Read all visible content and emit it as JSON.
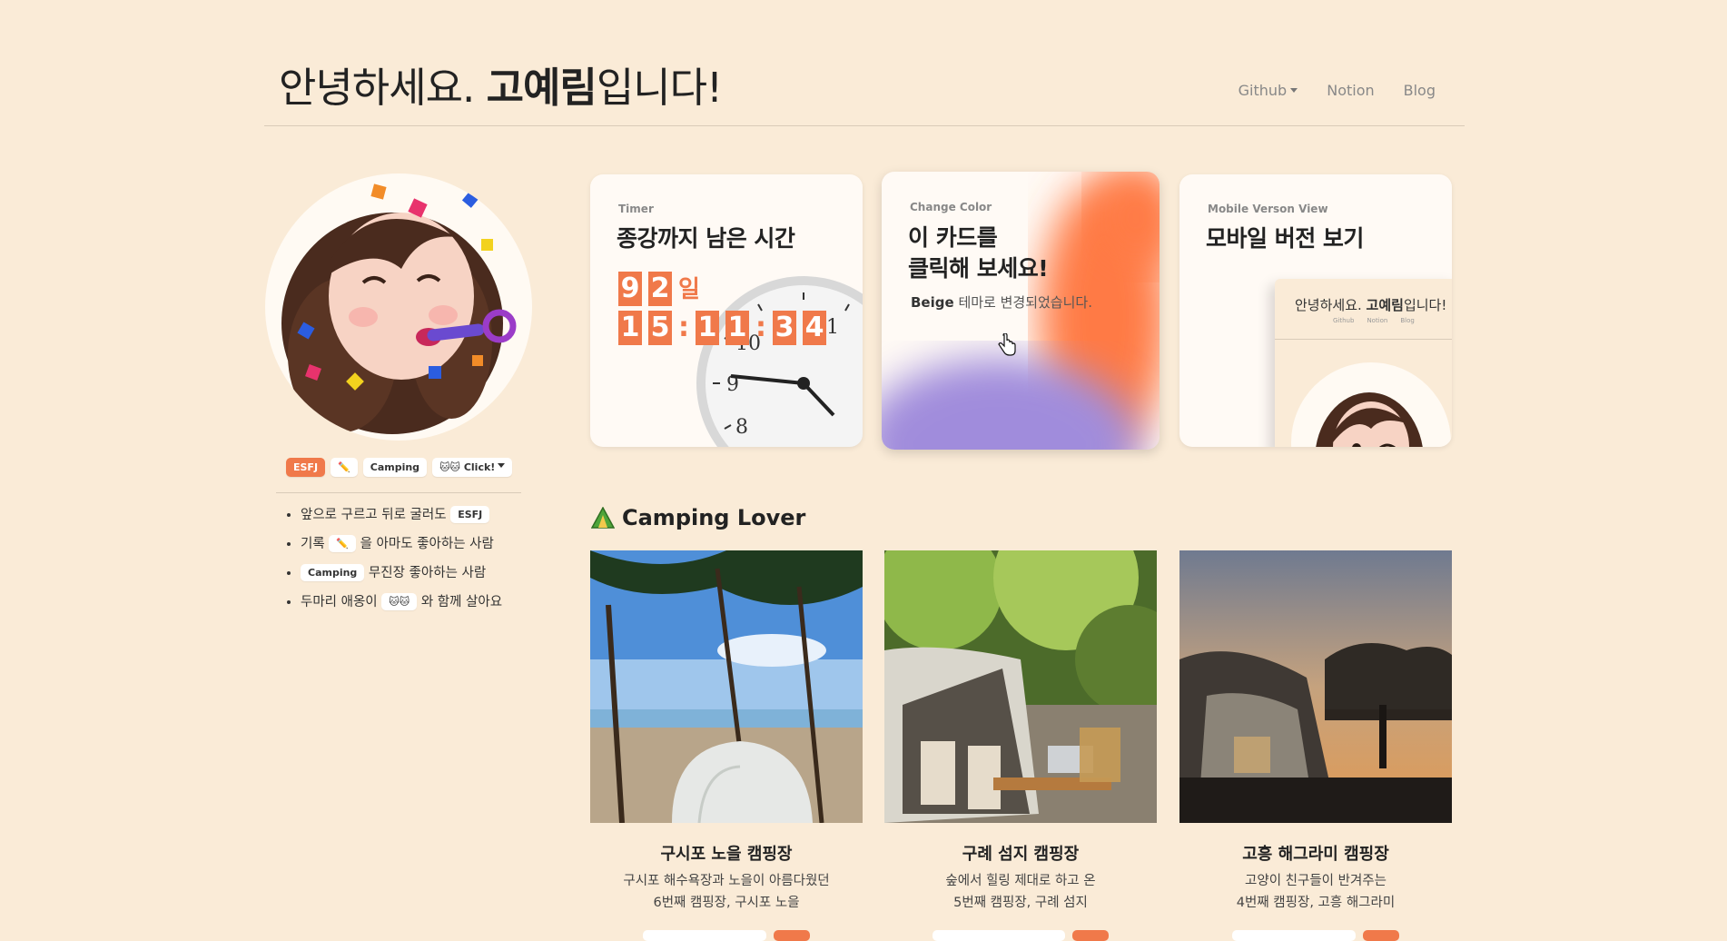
{
  "header": {
    "title_pre": "안녕하세요. ",
    "title_name": "고예림",
    "title_post": "입니다!",
    "nav": {
      "github": "Github",
      "notion": "Notion",
      "blog": "Blog"
    }
  },
  "profile": {
    "badges": [
      "ESFJ",
      "✏️",
      "Camping",
      "🐱🐱 Click!"
    ],
    "bio": [
      {
        "pre": "앞으로 구르고 뒤로 굴러도",
        "chip": "ESFJ",
        "post": ""
      },
      {
        "pre": "기록",
        "chip": "✏️",
        "post": "을 아마도 좋아하는 사람"
      },
      {
        "pre": "",
        "chip": "Camping",
        "post": "무진장 좋아하는 사람"
      },
      {
        "pre": "두마리 애옹이",
        "chip": "🐱🐱",
        "post": "와 함께 살아요"
      }
    ]
  },
  "cards": {
    "timer": {
      "label": "Timer",
      "heading": "종강까지 남은 시간",
      "days": [
        "9",
        "2"
      ],
      "day_unit": "일",
      "hours": [
        "1",
        "5"
      ],
      "minutes": [
        "1",
        "1"
      ],
      "seconds": [
        "3",
        "4"
      ],
      "colon": ":",
      "clock_numerals": [
        "1",
        "10",
        "9",
        "8"
      ]
    },
    "color": {
      "label": "Change Color",
      "heading_line1": "이 카드를",
      "heading_line2": "클릭해 보세요!",
      "sub_strong": "Beige",
      "sub_rest": " 테마로 변경되었습니다."
    },
    "mobile": {
      "label": "Mobile Verson View",
      "heading": "모바일 버전 보기",
      "preview_pre": "안녕하세요. ",
      "preview_name": "고예림",
      "preview_post": "입니다!",
      "preview_nav": [
        "Github",
        "Notion",
        "Blog"
      ]
    }
  },
  "camping": {
    "title": "Camping Lover",
    "places": [
      {
        "name": "구시포 노을 캠핑장",
        "desc1": "구시포 해수욕장과 노을이 아름다웠던",
        "desc2": "6번째 캠핑장, 구시포 노을"
      },
      {
        "name": "구례 섬지 캠핑장",
        "desc1": "숲에서 힐링 제대로 하고 온",
        "desc2": "5번째 캠핑장, 구례 섬지"
      },
      {
        "name": "고흥 해그라미 캠핑장",
        "desc1": "고양이 친구들이 반겨주는",
        "desc2": "4번째 캠핑장, 고흥 해그라미"
      }
    ]
  },
  "colors": {
    "background": "#faebd7",
    "accent": "#f0794a",
    "purple": "#a08cdc"
  }
}
